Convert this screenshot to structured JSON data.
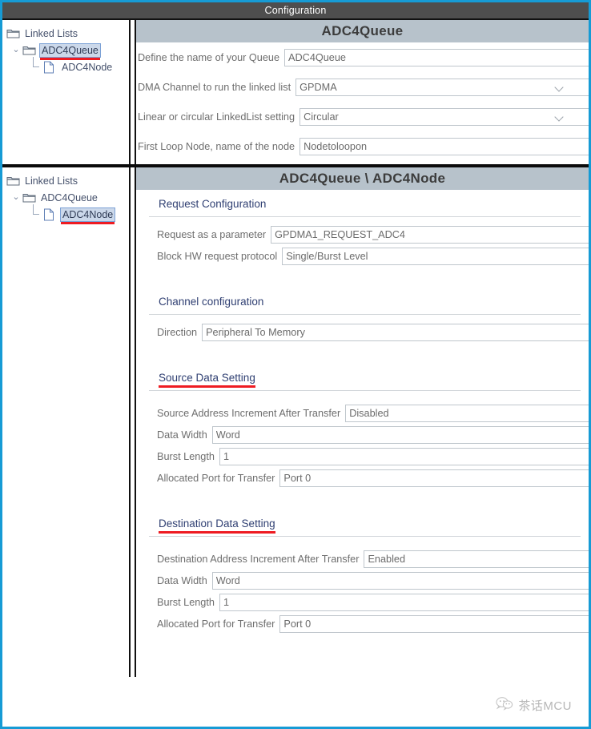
{
  "window": {
    "title": "Configuration",
    "accent_border": "#169bd5",
    "titlebar_bg": "#4e4e4e",
    "section_header_bg": "#b7c2cb",
    "annotation_color": "#ee1c22",
    "selection_bg": "#cbd8ea"
  },
  "top_pane": {
    "tree": {
      "items": [
        {
          "label": "Linked Lists",
          "icon": "folder-icon",
          "depth": 0,
          "selected": false,
          "annotated": false
        },
        {
          "label": "ADC4Queue",
          "icon": "folder-icon",
          "depth": 1,
          "selected": true,
          "annotated": true
        },
        {
          "label": "ADC4Node",
          "icon": "file-icon",
          "depth": 2,
          "selected": false,
          "annotated": false
        }
      ]
    },
    "header": "ADC4Queue",
    "fields": [
      {
        "label": "Define the name of your Queue",
        "value": "ADC4Queue",
        "control": "text"
      },
      {
        "label": "DMA Channel to run the linked list",
        "value": "GPDMA",
        "control": "dropdown"
      },
      {
        "label": "Linear or circular LinkedList setting",
        "value": "Circular",
        "control": "dropdown"
      },
      {
        "label": "First Loop Node, name of the node",
        "value": "Nodetoloopon",
        "control": "text"
      }
    ]
  },
  "bottom_pane": {
    "tree": {
      "items": [
        {
          "label": "Linked Lists",
          "icon": "folder-icon",
          "depth": 0,
          "selected": false,
          "annotated": false
        },
        {
          "label": "ADC4Queue",
          "icon": "folder-icon",
          "depth": 1,
          "selected": false,
          "annotated": false
        },
        {
          "label": "ADC4Node",
          "icon": "file-icon",
          "depth": 2,
          "selected": true,
          "annotated": true
        }
      ]
    },
    "header": "ADC4Queue \\ ADC4Node",
    "groups": [
      {
        "title": "Request Configuration",
        "annotated": false,
        "fields": [
          {
            "label": "Request as a parameter",
            "value": "GPDMA1_REQUEST_ADC4",
            "control": "text"
          },
          {
            "label": "Block HW request protocol",
            "value": "Single/Burst Level",
            "control": "text"
          }
        ]
      },
      {
        "title": "Channel configuration",
        "annotated": false,
        "fields": [
          {
            "label": "Direction",
            "value": "Peripheral To Memory",
            "control": "text"
          }
        ]
      },
      {
        "title": "Source Data Setting",
        "annotated": true,
        "fields": [
          {
            "label": "Source Address Increment After Transfer",
            "value": "Disabled",
            "control": "text"
          },
          {
            "label": "Data Width",
            "value": "Word",
            "control": "text"
          },
          {
            "label": "Burst Length",
            "value": "1",
            "control": "text"
          },
          {
            "label": "Allocated Port for Transfer",
            "value": "Port 0",
            "control": "text"
          }
        ]
      },
      {
        "title": "Destination Data Setting",
        "annotated": true,
        "fields": [
          {
            "label": "Destination Address Increment After Transfer",
            "value": "Enabled",
            "control": "text"
          },
          {
            "label": "Data Width",
            "value": "Word",
            "control": "text"
          },
          {
            "label": "Burst Length",
            "value": "1",
            "control": "text"
          },
          {
            "label": "Allocated Port for Transfer",
            "value": "Port 0",
            "control": "text"
          }
        ]
      }
    ]
  },
  "footer": {
    "watermark_text": "茶话MCU",
    "watermark_icon": "wechat-icon"
  }
}
